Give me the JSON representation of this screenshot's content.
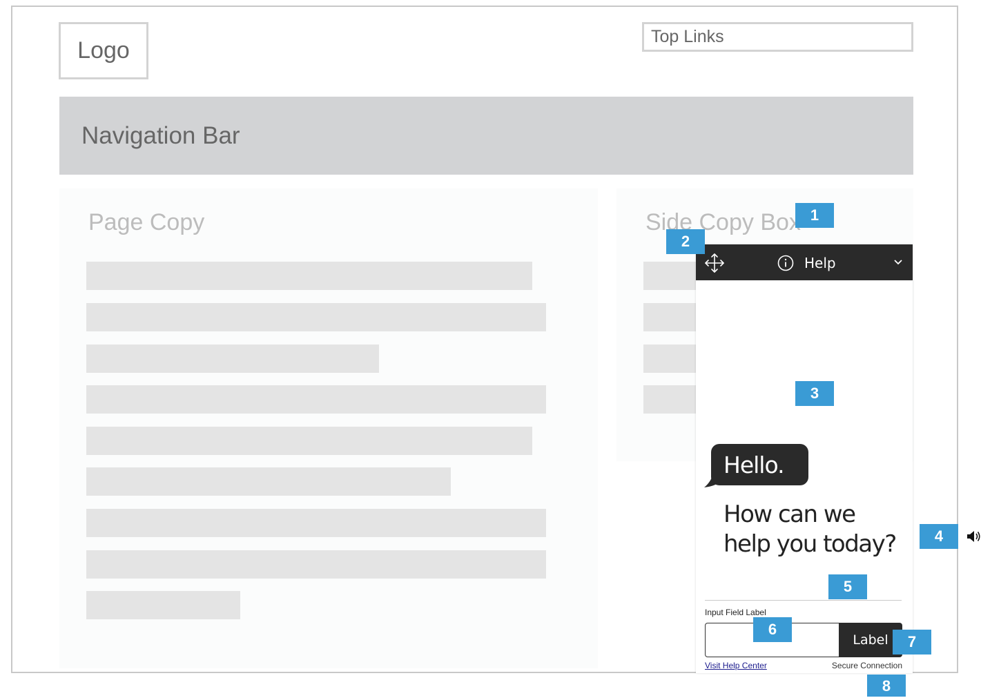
{
  "header": {
    "logo_label": "Logo",
    "top_links_label": "Top Links"
  },
  "nav": {
    "label": "Navigation Bar"
  },
  "page_copy": {
    "title": "Page Copy"
  },
  "side_copy": {
    "title": "Side Copy Box"
  },
  "widget": {
    "header": {
      "move_icon": "move-icon",
      "info_icon": "info-icon",
      "title": "Help",
      "chevron_icon": "chevron-down-icon"
    },
    "greeting": "Hello.",
    "question_line1": "How can we",
    "question_line2": "help you today?",
    "input_label": "Input Field Label",
    "input_value": "",
    "send_label": "Label",
    "help_center_link": "Visit Help Center",
    "secure_text": "Secure Connection"
  },
  "callouts": [
    "1",
    "2",
    "3",
    "4",
    "5",
    "6",
    "7",
    "8"
  ],
  "colors": {
    "accent": "#3a9bd5",
    "dark": "#2a2a2a",
    "nav_bg": "#d2d3d5",
    "placeholder_bar": "#e4e4e4"
  }
}
